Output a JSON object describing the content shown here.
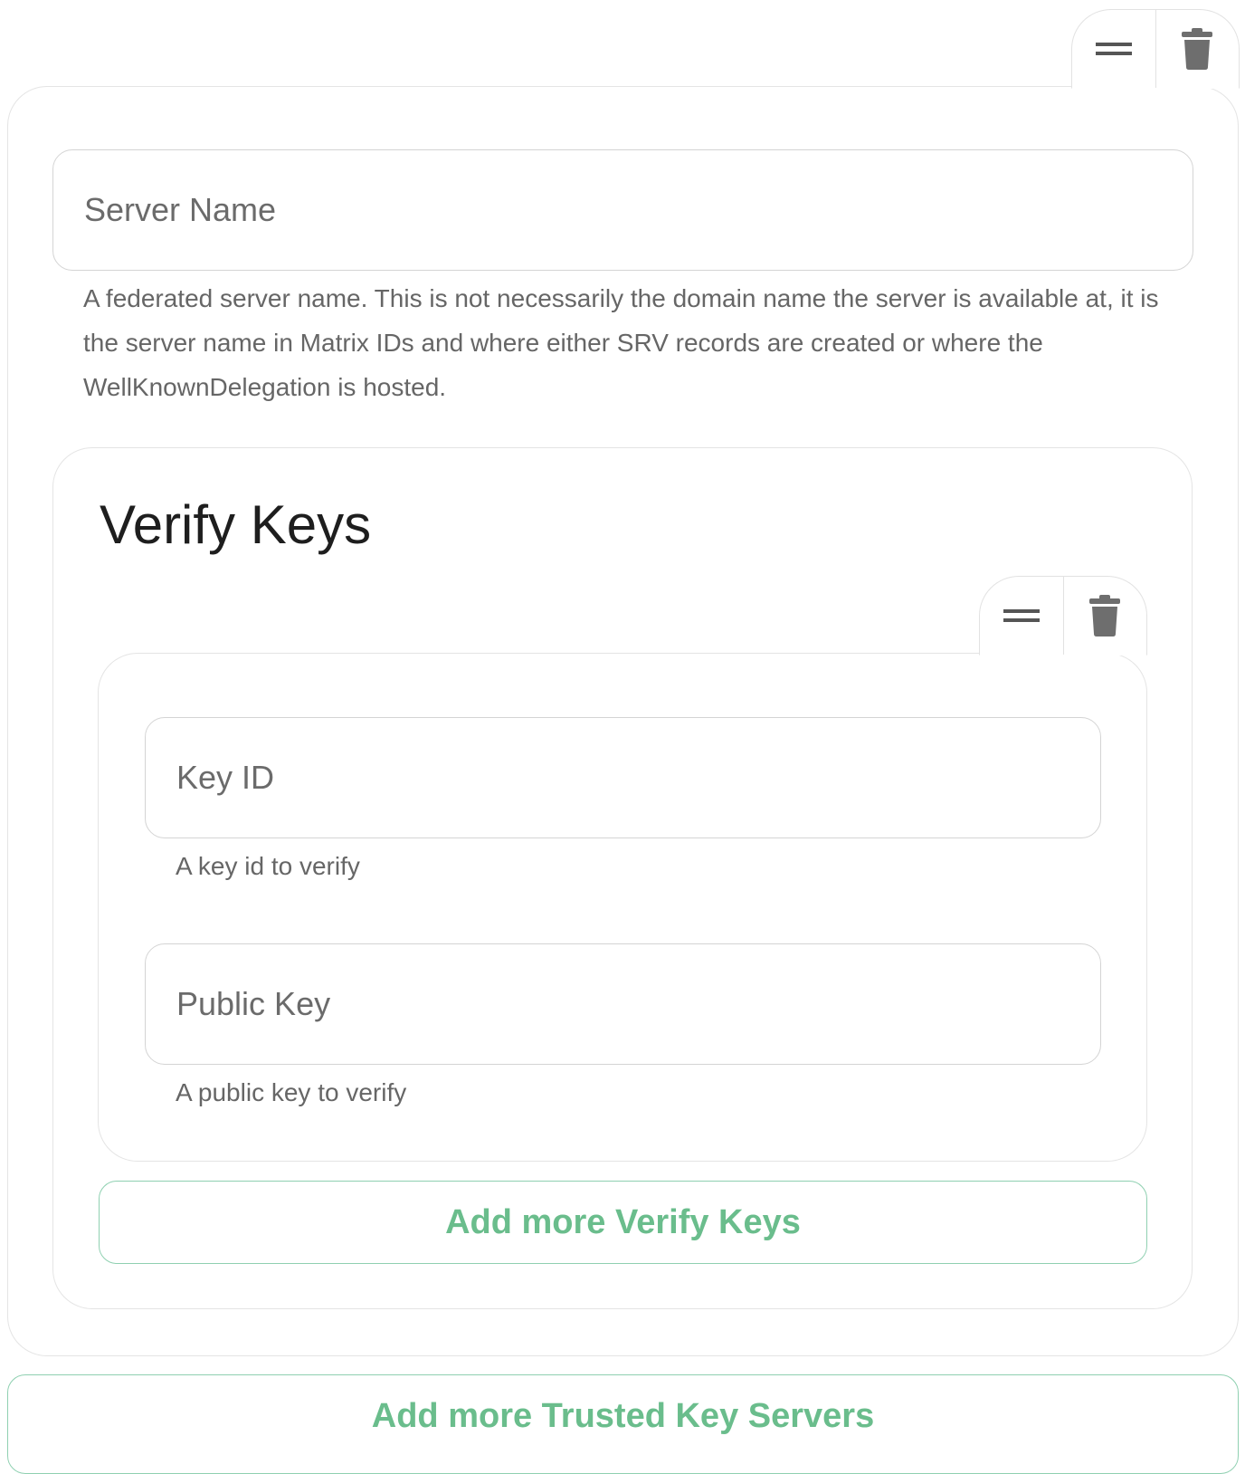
{
  "server": {
    "name_placeholder": "Server Name",
    "name_value": "",
    "help": "A federated server name. This is not necessarily the domain name the server is available at, it is the server name in Matrix IDs and where either SRV records are created or where the WellKnownDelegation is hosted."
  },
  "verify_keys": {
    "title": "Verify Keys",
    "key_id": {
      "placeholder": "Key ID",
      "value": "",
      "help": "A key id to verify"
    },
    "public_key": {
      "placeholder": "Public Key",
      "value": "",
      "help": "A public key to verify"
    },
    "add_label": "Add more Verify Keys"
  },
  "add_servers_label": "Add more Trusted Key Servers",
  "icons": {
    "drag": "drag-handle-icon",
    "delete": "trash-icon"
  },
  "colors": {
    "accent_green": "#6abd8c",
    "icon_gray": "#555555",
    "border": "#e4e4e4"
  }
}
